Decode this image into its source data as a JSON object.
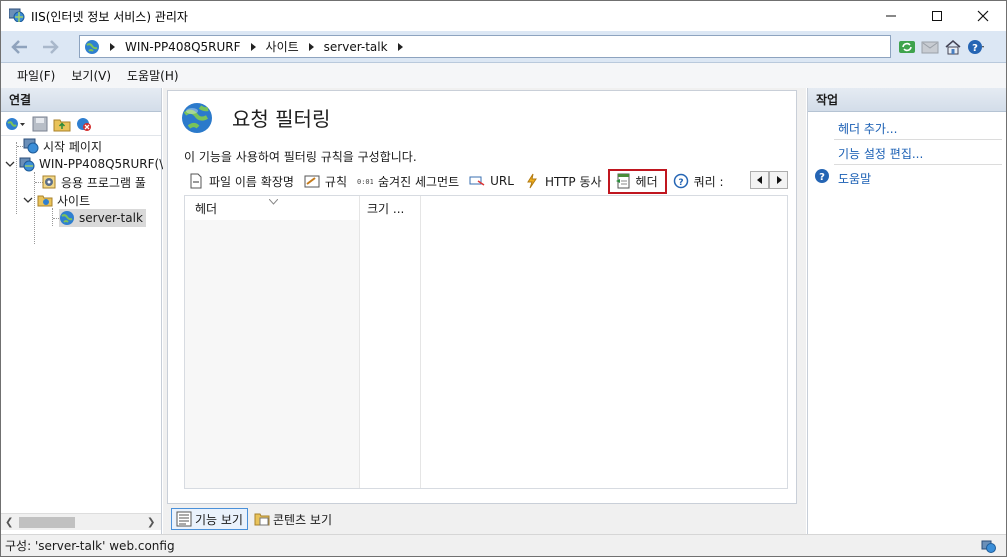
{
  "window": {
    "title": "IIS(인터넷 정보 서비스) 관리자"
  },
  "address": {
    "crumbs": [
      "WIN-PP408Q5RURF",
      "사이트",
      "server-talk"
    ]
  },
  "menu": {
    "items": [
      "파일(F)",
      "보기(V)",
      "도움말(H)"
    ]
  },
  "connections": {
    "header": "연결",
    "tree": {
      "start_page": "시작 페이지",
      "server": "WIN-PP408Q5RURF(\\",
      "app_pools": "응용 프로그램 풀",
      "sites": "사이트",
      "site": "server-talk"
    }
  },
  "main": {
    "title": "요청 필터링",
    "description": "이 기능을 사용하여 필터링 규칙을 구성합니다.",
    "tabs": [
      "파일 이름 확장명",
      "규칙",
      "숨겨진 세그먼트",
      "URL",
      "HTTP 동사",
      "헤더",
      "쿼리 :"
    ],
    "selected_tab": "헤더",
    "grid_columns": [
      "헤더",
      "크기 ..."
    ],
    "bottom_tabs": [
      "기능 보기",
      "콘텐츠 보기"
    ]
  },
  "actions": {
    "header": "작업",
    "add_header": "헤더 추가...",
    "edit_settings": "기능 설정 편집...",
    "help": "도움말"
  },
  "status": {
    "text": "구성: 'server-talk' web.config"
  },
  "colors": {
    "highlight_border": "#c0161f",
    "link": "#1a5fb4",
    "address_bar_bg": "#dce7f4"
  }
}
